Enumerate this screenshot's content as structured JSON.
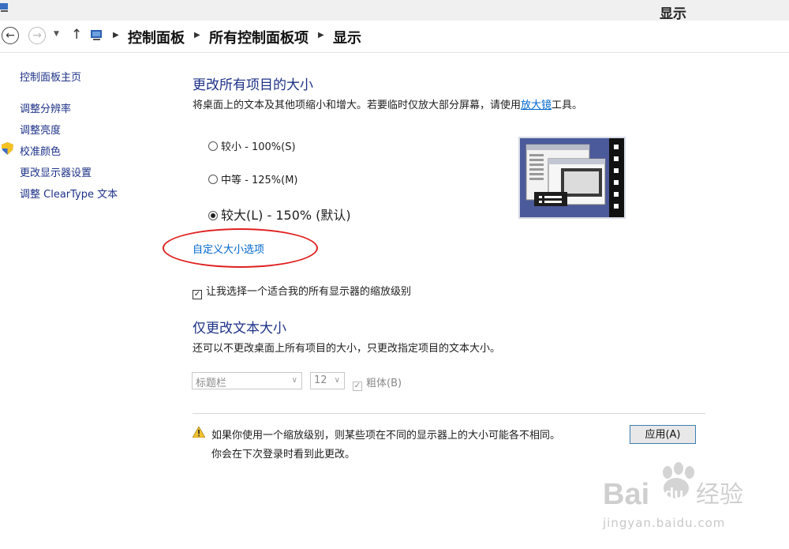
{
  "window": {
    "title": "显示"
  },
  "nav": {
    "back_icon": "back-arrow-icon",
    "forward_icon": "forward-arrow-icon",
    "up_icon": "up-arrow-icon",
    "breadcrumb": [
      "控制面板",
      "所有控制面板项",
      "显示"
    ]
  },
  "sidebar": {
    "items": [
      {
        "label": "控制面板主页"
      },
      {
        "label": "调整分辨率"
      },
      {
        "label": "调整亮度"
      },
      {
        "label": "校准颜色",
        "icon": "shield-icon"
      },
      {
        "label": "更改显示器设置"
      },
      {
        "label": "调整 ClearType 文本"
      }
    ]
  },
  "scale_section": {
    "heading": "更改所有项目的大小",
    "desc_before": "将桌面上的文本及其他项缩小和增大。若要临时仅放大部分屏幕，请使用",
    "desc_link": "放大镜",
    "desc_after": "工具。",
    "options": [
      {
        "label": "较小 - 100%(S)",
        "checked": false
      },
      {
        "label": "中等 - 125%(M)",
        "checked": false
      },
      {
        "label": "较大(L) - 150% (默认)",
        "checked": true
      }
    ],
    "custom_link": "自定义大小选项",
    "checkbox_label": "让我选择一个适合我的所有显示器的缩放级别",
    "checkbox_checked": true
  },
  "text_section": {
    "heading": "仅更改文本大小",
    "desc": "还可以不更改桌面上所有项目的大小，只更改指定项目的文本大小。",
    "item_select": "标题栏",
    "size_select": "12",
    "bold_label": "粗体(B)",
    "bold_checked": true
  },
  "footer": {
    "warning_icon": "warning-icon",
    "warning_line1": "如果你使用一个缩放级别，则某些项在不同的显示器上的大小可能各不相同。",
    "warning_line2": "你会在下次登录时看到此更改。",
    "apply_label": "应用(A)"
  },
  "watermark": {
    "text": "Bai du 经验",
    "url": "jingyan.baidu.com"
  },
  "colors": {
    "link": "#0066cc",
    "heading": "#1e3287",
    "annotation": "#e02020",
    "preview_bg": "#4a5a9b"
  }
}
